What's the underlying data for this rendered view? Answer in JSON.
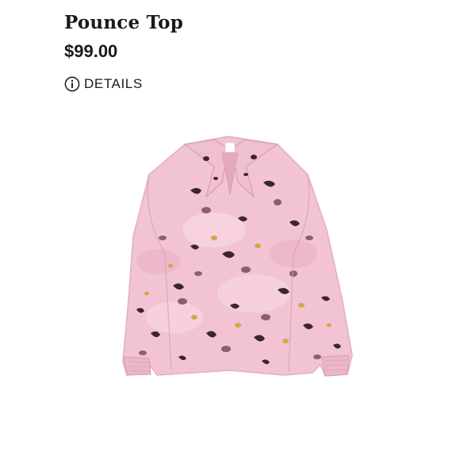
{
  "product": {
    "title": "Pounce Top",
    "price": "$99.00"
  },
  "details": {
    "label": "DETAILS",
    "icon": "info-icon"
  },
  "image": {
    "subject": "pink leopard-print long-sleeve collared blouse",
    "colors": {
      "base": "#f2c4d3",
      "spots_dark": "#3b2530",
      "spots_mauve": "#8a5f6e",
      "spots_gold": "#d6a54a"
    }
  }
}
